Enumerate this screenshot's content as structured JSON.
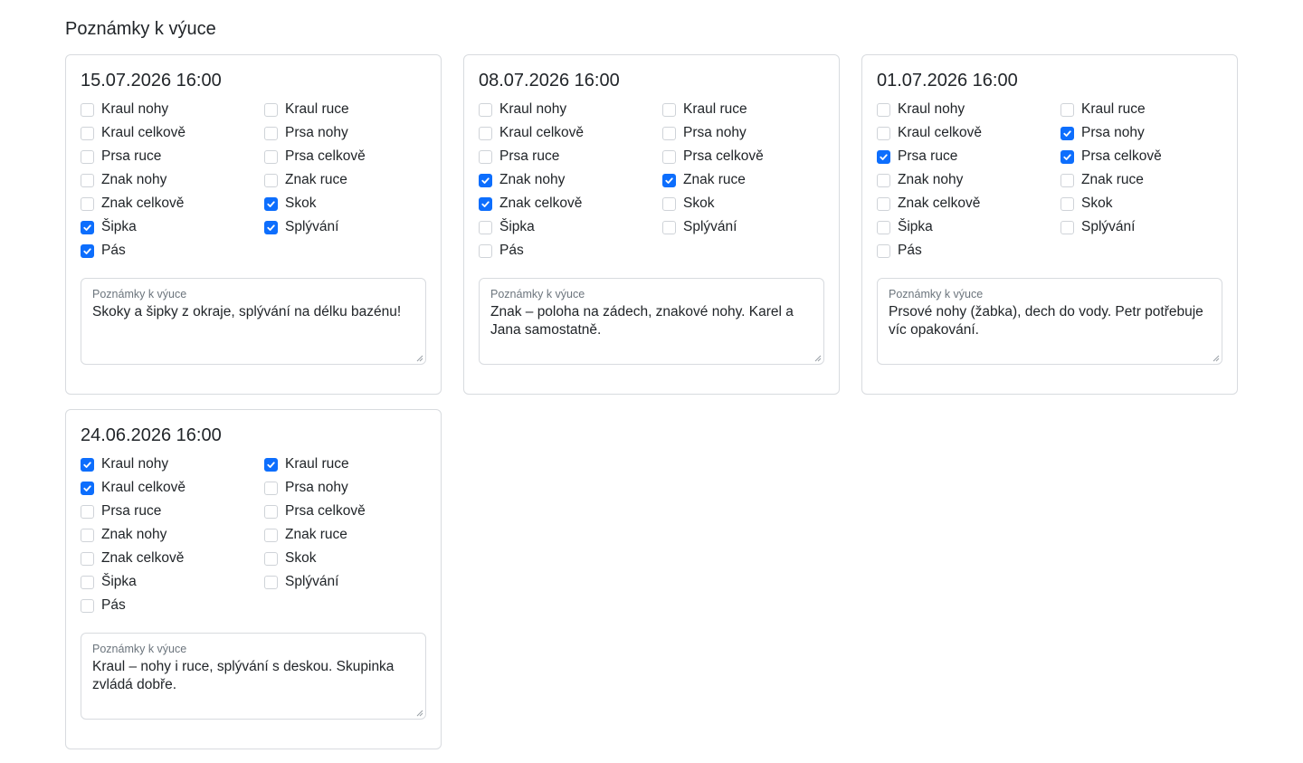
{
  "page": {
    "title": "Poznámky k výuce"
  },
  "colors": {
    "accent": "#0d6efd",
    "border": "#d8dbdf",
    "muted": "#6c757d"
  },
  "cards": [
    {
      "date": "15.07.2026 16:00",
      "items": [
        {
          "label": "Kraul nohy",
          "checked": false
        },
        {
          "label": "Kraul ruce",
          "checked": false
        },
        {
          "label": "Kraul celkově",
          "checked": false
        },
        {
          "label": "Prsa nohy",
          "checked": false
        },
        {
          "label": "Prsa ruce",
          "checked": false
        },
        {
          "label": "Prsa celkově",
          "checked": false
        },
        {
          "label": "Znak nohy",
          "checked": false
        },
        {
          "label": "Znak ruce",
          "checked": false
        },
        {
          "label": "Znak celkově",
          "checked": false
        },
        {
          "label": "Skok",
          "checked": true
        },
        {
          "label": "Šipka",
          "checked": true
        },
        {
          "label": "Splývání",
          "checked": true
        },
        {
          "label": "Pás",
          "checked": true
        }
      ],
      "notes_label": "Poznámky k výuce",
      "notes_value": "Skoky a šipky z okraje, splývání na délku bazénu!"
    },
    {
      "date": "08.07.2026 16:00",
      "items": [
        {
          "label": "Kraul nohy",
          "checked": false
        },
        {
          "label": "Kraul ruce",
          "checked": false
        },
        {
          "label": "Kraul celkově",
          "checked": false
        },
        {
          "label": "Prsa nohy",
          "checked": false
        },
        {
          "label": "Prsa ruce",
          "checked": false
        },
        {
          "label": "Prsa celkově",
          "checked": false
        },
        {
          "label": "Znak nohy",
          "checked": true
        },
        {
          "label": "Znak ruce",
          "checked": true
        },
        {
          "label": "Znak celkově",
          "checked": true
        },
        {
          "label": "Skok",
          "checked": false
        },
        {
          "label": "Šipka",
          "checked": false
        },
        {
          "label": "Splývání",
          "checked": false
        },
        {
          "label": "Pás",
          "checked": false
        }
      ],
      "notes_label": "Poznámky k výuce",
      "notes_value": "Znak – poloha na zádech, znakové nohy. Karel a Jana samostatně."
    },
    {
      "date": "01.07.2026 16:00",
      "items": [
        {
          "label": "Kraul nohy",
          "checked": false
        },
        {
          "label": "Kraul ruce",
          "checked": false
        },
        {
          "label": "Kraul celkově",
          "checked": false
        },
        {
          "label": "Prsa nohy",
          "checked": true
        },
        {
          "label": "Prsa ruce",
          "checked": true
        },
        {
          "label": "Prsa celkově",
          "checked": true
        },
        {
          "label": "Znak nohy",
          "checked": false
        },
        {
          "label": "Znak ruce",
          "checked": false
        },
        {
          "label": "Znak celkově",
          "checked": false
        },
        {
          "label": "Skok",
          "checked": false
        },
        {
          "label": "Šipka",
          "checked": false
        },
        {
          "label": "Splývání",
          "checked": false
        },
        {
          "label": "Pás",
          "checked": false
        }
      ],
      "notes_label": "Poznámky k výuce",
      "notes_value": "Prsové nohy (žabka), dech do vody. Petr potřebuje víc opakování."
    },
    {
      "date": "24.06.2026 16:00",
      "items": [
        {
          "label": "Kraul nohy",
          "checked": true
        },
        {
          "label": "Kraul ruce",
          "checked": true
        },
        {
          "label": "Kraul celkově",
          "checked": true
        },
        {
          "label": "Prsa nohy",
          "checked": false
        },
        {
          "label": "Prsa ruce",
          "checked": false
        },
        {
          "label": "Prsa celkově",
          "checked": false
        },
        {
          "label": "Znak nohy",
          "checked": false
        },
        {
          "label": "Znak ruce",
          "checked": false
        },
        {
          "label": "Znak celkově",
          "checked": false
        },
        {
          "label": "Skok",
          "checked": false
        },
        {
          "label": "Šipka",
          "checked": false
        },
        {
          "label": "Splývání",
          "checked": false
        },
        {
          "label": "Pás",
          "checked": false
        }
      ],
      "notes_label": "Poznámky k výuce",
      "notes_value": "Kraul – nohy i ruce, splývání s deskou. Skupinka zvládá dobře."
    }
  ]
}
